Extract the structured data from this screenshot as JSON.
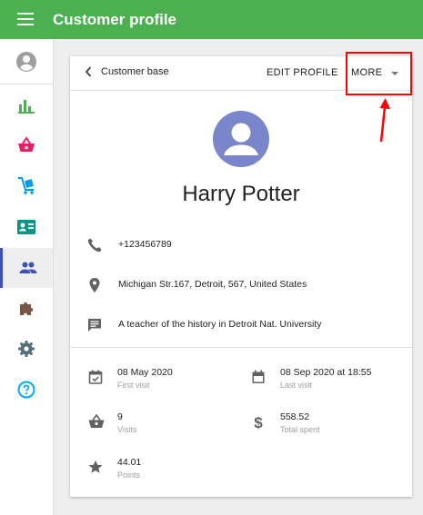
{
  "app": {
    "title": "Customer profile"
  },
  "header": {
    "back_label": "Customer base",
    "edit_label": "EDIT PROFILE",
    "more_label": "MORE"
  },
  "sidebar": {
    "items": [
      {
        "icon": "account-circle-icon",
        "color": "#9e9e9e"
      },
      {
        "icon": "bar-chart-icon",
        "color": "#4caf50"
      },
      {
        "icon": "basket-icon",
        "color": "#e91e63"
      },
      {
        "icon": "delivery-cart-icon",
        "color": "#039be5"
      },
      {
        "icon": "id-card-icon",
        "color": "#009688"
      },
      {
        "icon": "people-icon",
        "color": "#3f51b5",
        "active": true
      },
      {
        "icon": "puzzle-icon",
        "color": "#795548"
      },
      {
        "icon": "gear-icon",
        "color": "#546e7a"
      },
      {
        "icon": "help-icon",
        "color": "#03a9f4"
      }
    ]
  },
  "customer": {
    "name": "Harry Potter",
    "phone": "+123456789",
    "address": "Michigan Str.167, Detroit, 567, United States",
    "note": "A teacher of the history in Detroit Nat. University"
  },
  "stats": {
    "first_visit": {
      "value": "08 May 2020",
      "label": "First visit"
    },
    "last_visit": {
      "value": "08 Sep 2020 at 18:55",
      "label": "Last visit"
    },
    "visits": {
      "value": "9",
      "label": "Visits"
    },
    "total_spent": {
      "value": "558.52",
      "label": "Total spent"
    },
    "points": {
      "value": "44.01",
      "label": "Points"
    }
  },
  "colors": {
    "primary": "#4caf50",
    "avatar": "#7986cb",
    "annotation": "#ff0000"
  }
}
